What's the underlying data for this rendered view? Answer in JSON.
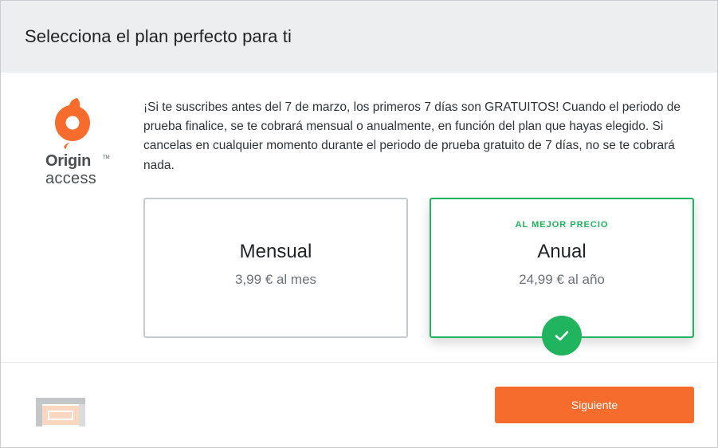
{
  "header": {
    "title": "Selecciona el plan perfecto para ti"
  },
  "logo": {
    "word1": "Origin",
    "word2": "access",
    "tm": "TM",
    "icon": "origin-logo-icon"
  },
  "promo": {
    "text": "¡Si te suscribes antes del 7 de marzo, los primeros 7 días son GRATUITOS! Cuando el periodo de prueba finalice, se te cobrará mensual o anualmente, en función del plan que hayas elegido. Si cancelas en cualquier momento durante el periodo de prueba gratuito de 7 días, no se te cobrará nada."
  },
  "plans": [
    {
      "badge": "",
      "name": "Mensual",
      "price": "3,99 € al mes",
      "selected": false
    },
    {
      "badge": "AL MEJOR PRECIO",
      "name": "Anual",
      "price": "24,99 € al año",
      "selected": true
    }
  ],
  "footer": {
    "next_label": "Siguiente",
    "payment_icon": "credit-card-icon"
  },
  "colors": {
    "accent": "#f56c2d",
    "selected": "#1fb45d",
    "header_bg": "#eceeef"
  }
}
